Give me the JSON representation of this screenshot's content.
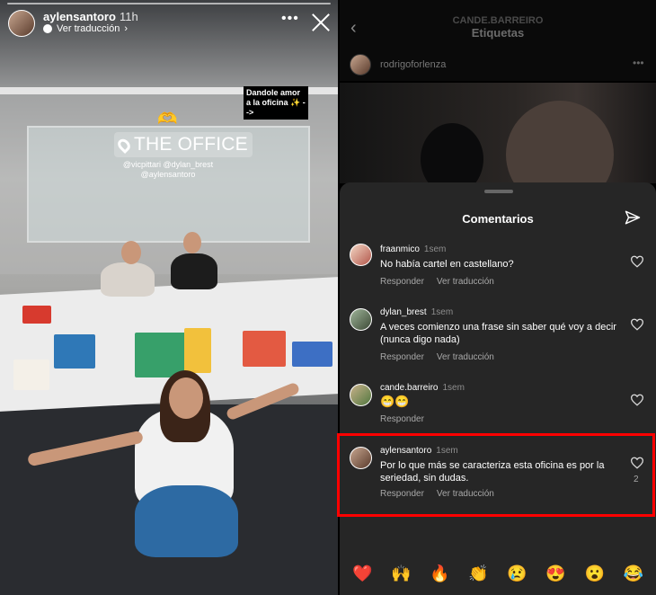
{
  "story": {
    "username": "aylensantoro",
    "time": "11h",
    "translate_label": "Ver traducción",
    "more_icon": "•••",
    "sticker_text": "Dandole amor a la oficina ✨ -->",
    "location": "THE OFFICE",
    "mentions_line1": "@vicpittari @dylan_brest",
    "mentions_line2": "@aylensantoro"
  },
  "header": {
    "subtitle": "CANDE.BARREIRO",
    "title": "Etiquetas",
    "post_user": "rodrigoforlenza",
    "more_icon": "•••"
  },
  "comments_sheet": {
    "title": "Comentarios",
    "reply_label": "Responder",
    "translate_label": "Ver traducción",
    "comments": [
      {
        "user": "fraanmico",
        "time": "1sem",
        "text": "No había cartel en castellano?",
        "has_translate": true,
        "likes": ""
      },
      {
        "user": "dylan_brest",
        "time": "1sem",
        "text": "A veces comienzo una frase sin saber qué voy a decir (nunca digo nada)",
        "has_translate": true,
        "likes": ""
      },
      {
        "user": "cande.barreiro",
        "time": "1sem",
        "text": "😁😁",
        "has_translate": false,
        "likes": ""
      },
      {
        "user": "aylensantoro",
        "time": "1sem",
        "text": "Por lo que más se caracteriza esta oficina es por la seriedad, sin dudas.",
        "has_translate": true,
        "likes": "2"
      }
    ]
  },
  "reactions": [
    "❤️",
    "🙌",
    "🔥",
    "👏",
    "😢",
    "😍",
    "😮",
    "😂"
  ],
  "colors": {
    "highlight": "#ff0000",
    "sheet_bg": "#262626"
  }
}
